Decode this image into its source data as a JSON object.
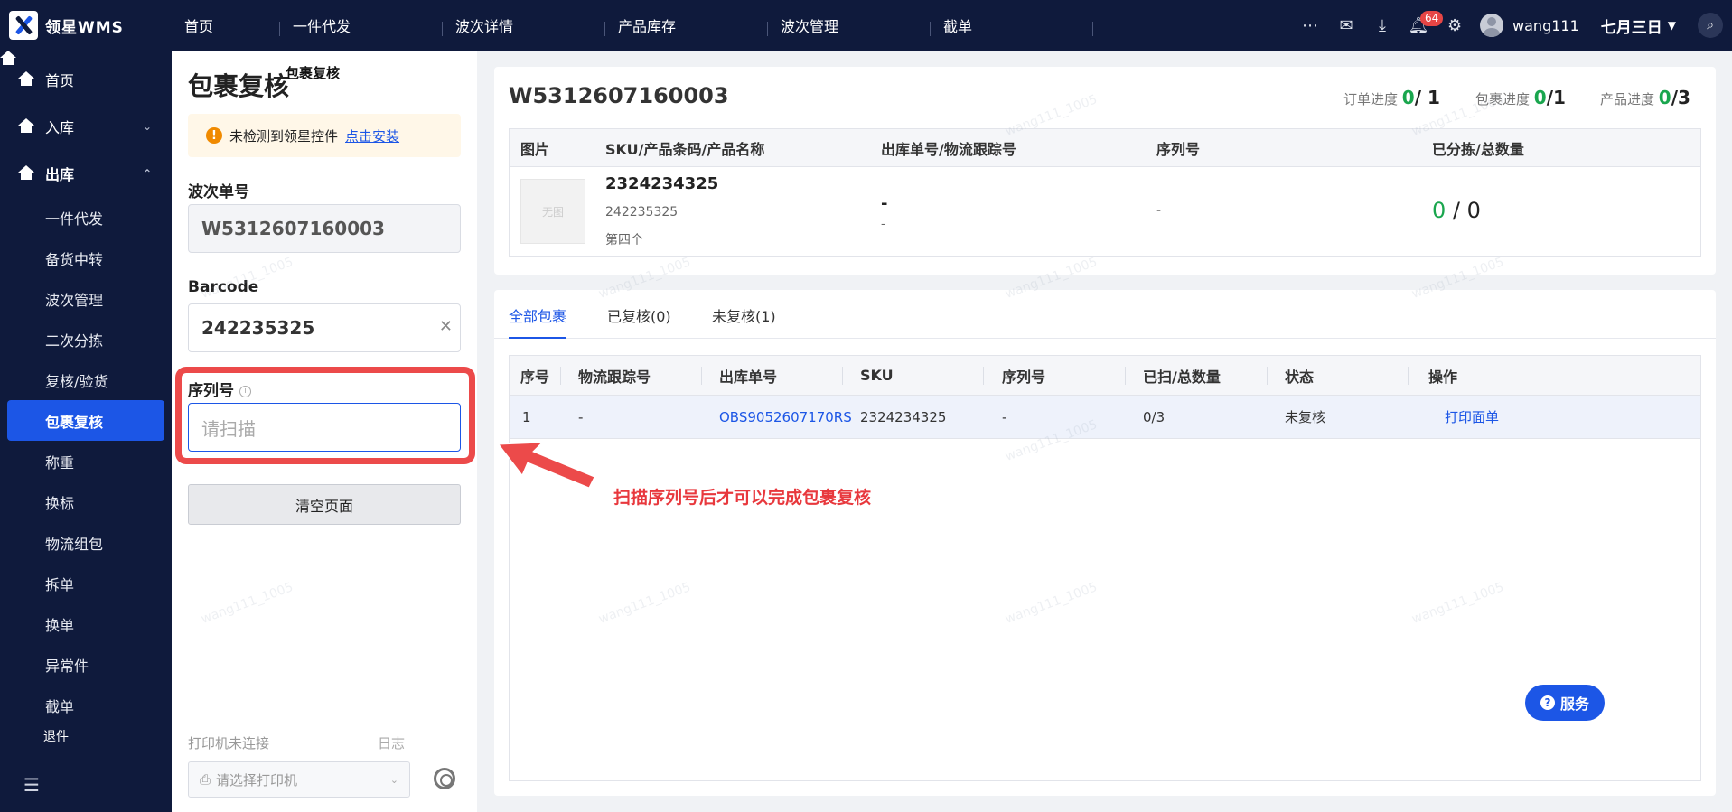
{
  "brand": {
    "name": "领星WMS"
  },
  "topnav": [
    "首页",
    "一件代发",
    "波次详情",
    "产品库存",
    "波次管理",
    "截单"
  ],
  "topbar": {
    "notifications_count": "64",
    "username": "wang111",
    "company": "七月三日"
  },
  "sidebar": {
    "items": [
      {
        "label": "首页"
      },
      {
        "label": "入库"
      },
      {
        "label": "出库"
      }
    ],
    "sub_items": [
      "一件代发",
      "备货中转",
      "波次管理",
      "二次分拣",
      "复核/验货",
      "包裹复核",
      "称重",
      "换标",
      "物流组包",
      "拆单",
      "换单",
      "异常件",
      "截单"
    ],
    "partial": "退件"
  },
  "left": {
    "title": "包裹复核",
    "tooltip": "包裹复核",
    "warning": "未检测到领星控件",
    "warning_link": "点击安装",
    "wave_label": "波次单号",
    "wave_value": "W5312607160003",
    "barcode_label": "Barcode",
    "barcode_value": "242235325",
    "serial_label": "序列号",
    "serial_placeholder": "请扫描",
    "clear_button": "清空页面",
    "printer_status": "打印机未连接",
    "printer_log": "日志",
    "printer_placeholder": "请选择打印机"
  },
  "detail": {
    "wave_no": "W5312607160003",
    "order_progress_label": "订单进度",
    "order_done": "0",
    "order_total": "/ 1",
    "package_progress_label": "包裹进度",
    "package_done": "0",
    "package_total": "/1",
    "product_progress_label": "产品进度",
    "product_done": "0",
    "product_total": "/3",
    "columns": [
      "图片",
      "SKU/产品条码/产品名称",
      "出库单号/物流跟踪号",
      "序列号",
      "已分拣/总数量"
    ],
    "row": {
      "image_placeholder": "无图",
      "sku": "2324234325",
      "barcode": "242235325",
      "name": "第四个",
      "outbound_no": "-",
      "tracking_no": "-",
      "serial": "-",
      "sorted": "0",
      "total": "/ 0"
    }
  },
  "packages": {
    "tabs": [
      "全部包裹",
      "已复核(0)",
      "未复核(1)"
    ],
    "columns": [
      "序号",
      "物流跟踪号",
      "出库单号",
      "SKU",
      "序列号",
      "已扫/总数量",
      "状态",
      "操作"
    ],
    "rows": [
      {
        "index": "1",
        "tracking": "-",
        "outbound": "OBS9052607170RS",
        "sku": "2324234325",
        "serial": "-",
        "scanned": "0/3",
        "status": "未复核",
        "action": "打印面单"
      }
    ]
  },
  "annotation": "扫描序列号后才可以完成包裹复核",
  "service_button": "服务",
  "watermark": "wang111_1005",
  "colors": {
    "nav_bg": "#0f1a3c",
    "accent": "#1c56e6",
    "success": "#1aa64e",
    "annotation": "#e8383d"
  }
}
